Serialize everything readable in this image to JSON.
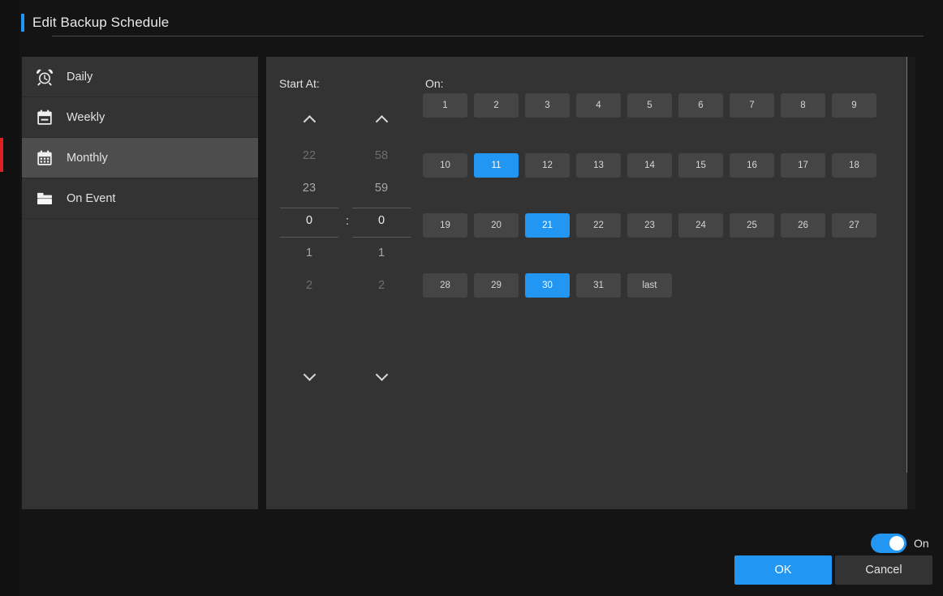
{
  "header": {
    "title": "Edit Backup Schedule",
    "accent_color": "#2196f3"
  },
  "sidebar": {
    "items": [
      {
        "label": "Daily",
        "icon": "alarm-clock-icon",
        "selected": false
      },
      {
        "label": "Weekly",
        "icon": "calendar-week-icon",
        "selected": false
      },
      {
        "label": "Monthly",
        "icon": "calendar-month-icon",
        "selected": true
      },
      {
        "label": "On Event",
        "icon": "folder-icon",
        "selected": false
      }
    ]
  },
  "content": {
    "start_at": {
      "label": "Start At:",
      "separator": ":",
      "hours": {
        "visible": [
          "22",
          "23",
          "0",
          "1",
          "2"
        ],
        "selected": "0",
        "selected_index": 2,
        "up_arrow": "chevron-up-icon",
        "down_arrow": "chevron-down-icon"
      },
      "minutes": {
        "visible": [
          "58",
          "59",
          "0",
          "1",
          "2"
        ],
        "selected": "0",
        "selected_index": 2,
        "up_arrow": "chevron-up-icon",
        "down_arrow": "chevron-down-icon"
      }
    },
    "on": {
      "label": "On:",
      "selected_days": [
        "11",
        "21",
        "30"
      ],
      "rows": [
        [
          "1",
          "2",
          "3",
          "4",
          "5",
          "6",
          "7",
          "8",
          "9"
        ],
        [
          "10",
          "11",
          "12",
          "13",
          "14",
          "15",
          "16",
          "17",
          "18"
        ],
        [
          "19",
          "20",
          "21",
          "22",
          "23",
          "24",
          "25",
          "26",
          "27"
        ],
        [
          "28",
          "29",
          "30",
          "31",
          "last"
        ]
      ]
    }
  },
  "footer": {
    "toggle": {
      "label": "On",
      "state": "on",
      "color": "#2196f3"
    },
    "ok_label": "OK",
    "cancel_label": "Cancel"
  },
  "colors": {
    "accent": "#2196f3",
    "panel": "#333333",
    "selected_row": "#4d4d4d",
    "day_button": "#454545",
    "window": "#141414",
    "red_marker": "#e02020"
  }
}
